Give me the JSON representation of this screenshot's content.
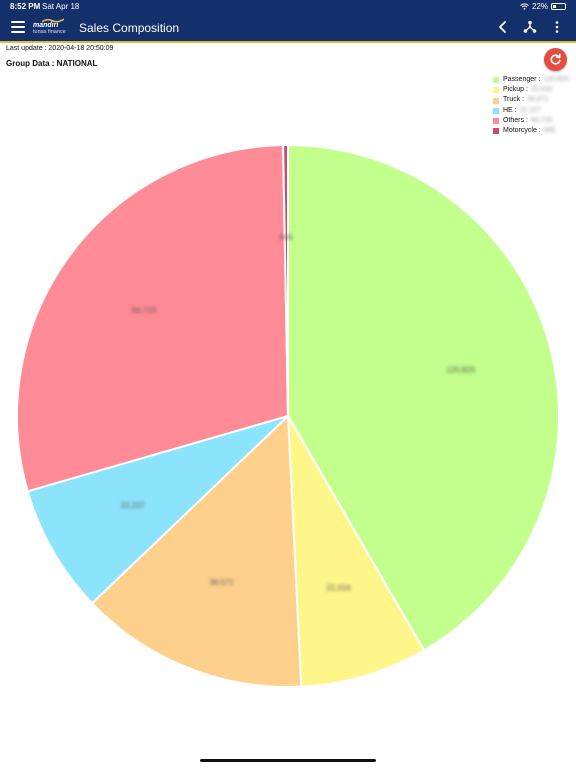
{
  "status_bar": {
    "time": "8:52 PM",
    "date": "Sat Apr 18",
    "battery": "22%"
  },
  "nav": {
    "logo_brand": "mandiri",
    "logo_sub": "tunas finance",
    "title": "Sales Composition",
    "icons": {
      "menu": "hamburger-menu-icon",
      "back": "chevron-left-icon",
      "share": "share-nodes-icon",
      "more": "more-vertical-icon",
      "refresh": "refresh-icon"
    }
  },
  "last_update": "Last update : 2020-04-18 20:50:09",
  "group_data": "Group Data : NATIONAL",
  "colors": {
    "nav_bg": "#14306b",
    "accent_line": "#e3b83a",
    "refresh_btn": "#e24d3e"
  },
  "chart_data": {
    "type": "pie",
    "legend_position": "top-right",
    "slices": [
      {
        "label": "Passenger",
        "legend_text": "Passenger :",
        "share": 0.4163,
        "color": "#c2ff8c",
        "value_text": "120,820"
      },
      {
        "label": "Pickup",
        "legend_text": "Pickup :",
        "share": 0.0759,
        "color": "#fff68a",
        "value_text": "22,016"
      },
      {
        "label": "Truck",
        "legend_text": "Truck :",
        "share": 0.1364,
        "color": "#ffd08c",
        "value_text": "39,571"
      },
      {
        "label": "HE",
        "legend_text": "HE :",
        "share": 0.0766,
        "color": "#8ce4fc",
        "value_text": "22,227"
      },
      {
        "label": "Others",
        "legend_text": "Others :",
        "share": 0.2919,
        "color": "#ff8b96",
        "value_text": "84,715"
      },
      {
        "label": "Motorcycle",
        "legend_text": "Motorcycle :",
        "share": 0.0029,
        "color": "#c94a7a",
        "value_text": "845"
      }
    ]
  }
}
